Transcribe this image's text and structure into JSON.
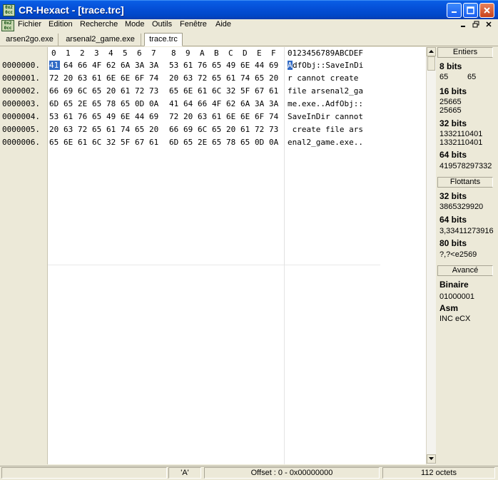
{
  "window": {
    "title": "CR-Hexact - [trace.trc]",
    "app_icon_text": "0x2\n0cc"
  },
  "menu": {
    "items": [
      "Fichier",
      "Edition",
      "Recherche",
      "Mode",
      "Outils",
      "Fenêtre",
      "Aide"
    ]
  },
  "tabs": [
    {
      "label": "arsen2go.exe",
      "active": false
    },
    {
      "label": "arsenal2_game.exe",
      "active": false
    },
    {
      "label": "trace.trc",
      "active": true
    }
  ],
  "hex_view": {
    "column_headers": [
      "0",
      "1",
      "2",
      "3",
      "4",
      "5",
      "6",
      "7",
      "8",
      "9",
      "A",
      "B",
      "C",
      "D",
      "E",
      "F"
    ],
    "ascii_header": "0123456789ABCDEF",
    "rows": [
      {
        "offset": "0000000.",
        "bytes": [
          "41",
          "64",
          "66",
          "4F",
          "62",
          "6A",
          "3A",
          "3A",
          "53",
          "61",
          "76",
          "65",
          "49",
          "6E",
          "44",
          "69"
        ],
        "ascii": "AdfObj::SaveInDi"
      },
      {
        "offset": "0000001.",
        "bytes": [
          "72",
          "20",
          "63",
          "61",
          "6E",
          "6E",
          "6F",
          "74",
          "20",
          "63",
          "72",
          "65",
          "61",
          "74",
          "65",
          "20"
        ],
        "ascii": "r cannot create "
      },
      {
        "offset": "0000002.",
        "bytes": [
          "66",
          "69",
          "6C",
          "65",
          "20",
          "61",
          "72",
          "73",
          "65",
          "6E",
          "61",
          "6C",
          "32",
          "5F",
          "67",
          "61"
        ],
        "ascii": "file arsenal2_ga"
      },
      {
        "offset": "0000003.",
        "bytes": [
          "6D",
          "65",
          "2E",
          "65",
          "78",
          "65",
          "0D",
          "0A",
          "41",
          "64",
          "66",
          "4F",
          "62",
          "6A",
          "3A",
          "3A"
        ],
        "ascii": "me.exe..AdfObj::"
      },
      {
        "offset": "0000004.",
        "bytes": [
          "53",
          "61",
          "76",
          "65",
          "49",
          "6E",
          "44",
          "69",
          "72",
          "20",
          "63",
          "61",
          "6E",
          "6E",
          "6F",
          "74"
        ],
        "ascii": "SaveInDir cannot"
      },
      {
        "offset": "0000005.",
        "bytes": [
          "20",
          "63",
          "72",
          "65",
          "61",
          "74",
          "65",
          "20",
          "66",
          "69",
          "6C",
          "65",
          "20",
          "61",
          "72",
          "73"
        ],
        "ascii": " create file ars"
      },
      {
        "offset": "0000006.",
        "bytes": [
          "65",
          "6E",
          "61",
          "6C",
          "32",
          "5F",
          "67",
          "61",
          "6D",
          "65",
          "2E",
          "65",
          "78",
          "65",
          "0D",
          "0A"
        ],
        "ascii": "enal2_game.exe.."
      }
    ],
    "selected_byte": "41",
    "selected_char": "A"
  },
  "panel": {
    "entiers_header": "Entiers",
    "bits8_label": "8 bits",
    "bits8_values": [
      "65",
      "65"
    ],
    "bits16_label": "16 bits",
    "bits16_values": [
      "25665",
      "25665"
    ],
    "bits32_label": "32 bits",
    "bits32_values": [
      "1332110401",
      "1332110401"
    ],
    "bits64_label": "64 bits",
    "bits64_value": "419578297332",
    "flottants_header": "Flottants",
    "f32_label": "32 bits",
    "f32_value": "3865329920",
    "f64_label": "64 bits",
    "f64_value": "3,33411273916",
    "f80_label": "80 bits",
    "f80_value": "?,?<e2569",
    "avance_header": "Avancé",
    "binaire_label": "Binaire",
    "binaire_value": "01000001",
    "asm_label": "Asm",
    "asm_value": "INC eCX"
  },
  "status": {
    "char": "'A'",
    "offset": "Offset : 0  -  0x00000000",
    "size": "112 octets"
  }
}
